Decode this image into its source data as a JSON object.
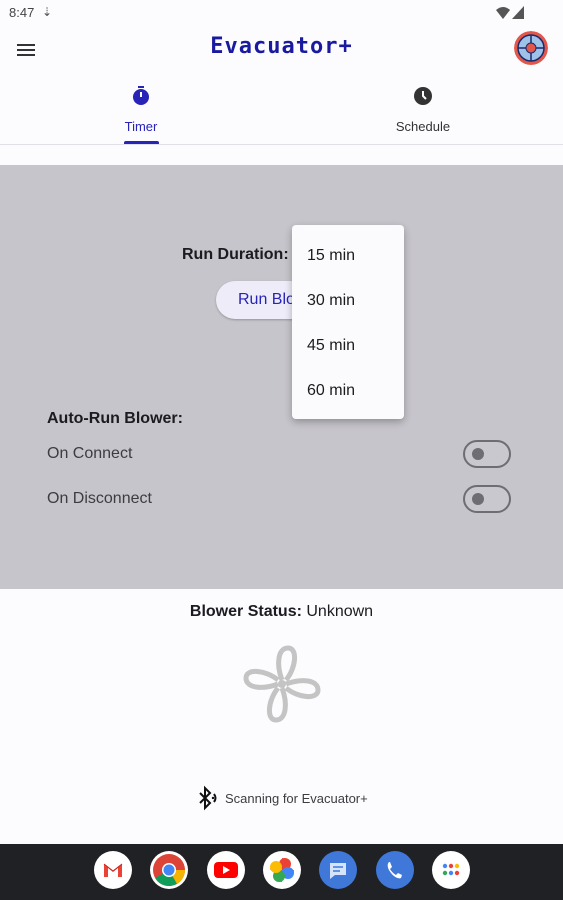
{
  "status_bar": {
    "time": "8:47",
    "notification_icon": "download-arrow-icon",
    "wifi_icon": "wifi-icon",
    "battery_icon": "signal-icon"
  },
  "app_bar": {
    "title": "Evacuator+",
    "menu_icon": "hamburger-menu-icon",
    "avatar_icon": "account-avatar-icon"
  },
  "tabs": [
    {
      "label": "Timer",
      "icon": "stopwatch-icon",
      "selected": true
    },
    {
      "label": "Schedule",
      "icon": "clock-icon",
      "selected": false
    }
  ],
  "run_duration": {
    "label": "Run Duration:",
    "button_label": "Run Blower"
  },
  "dropdown": {
    "options": [
      "15 min",
      "30 min",
      "45 min",
      "60 min"
    ]
  },
  "auto_run": {
    "title": "Auto-Run Blower:",
    "on_connect": {
      "label": "On Connect",
      "enabled": false
    },
    "on_disconnect": {
      "label": "On Disconnect",
      "enabled": false
    }
  },
  "blower_status": {
    "label": "Blower Status:",
    "value": "Unknown",
    "icon": "fan-icon"
  },
  "bluetooth": {
    "text": "Scanning for Evacuator+",
    "icon": "bluetooth-searching-icon"
  },
  "dock": [
    {
      "name": "gmail-icon"
    },
    {
      "name": "chrome-icon"
    },
    {
      "name": "youtube-icon"
    },
    {
      "name": "photos-icon"
    },
    {
      "name": "messages-icon"
    },
    {
      "name": "phone-icon"
    },
    {
      "name": "app-drawer-icon"
    }
  ],
  "colors": {
    "accent": "#2824b8",
    "panel": "#c6c5cb",
    "navbar": "#202124"
  }
}
